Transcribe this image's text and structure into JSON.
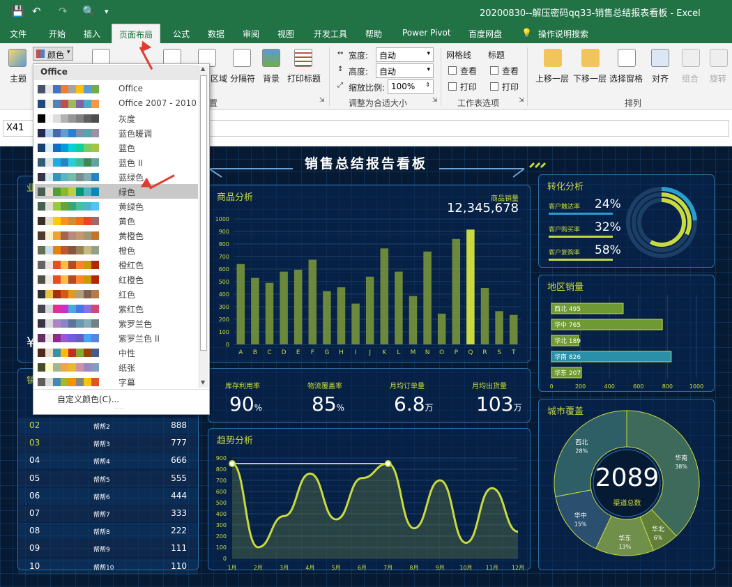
{
  "app": {
    "title": "20200830--解压密码qq33-销售总结报表看板 - Excel"
  },
  "tabs": [
    "文件",
    "开始",
    "插入",
    "页面布局",
    "公式",
    "数据",
    "审阅",
    "视图",
    "开发工具",
    "帮助",
    "Power Pivot",
    "百度网盘",
    "操作说明搜索"
  ],
  "active_tab": "页面布局",
  "ribbon": {
    "theme_label": "主题",
    "colors_label": "颜色",
    "page_setup": {
      "margin_label": "区域",
      "breaks_label": "分隔符",
      "background_label": "背景",
      "print_titles_label": "打印标题",
      "group_label": "置"
    },
    "scale": {
      "width_label": "宽度:",
      "width_value": "自动",
      "height_label": "高度:",
      "height_value": "自动",
      "zoom_label": "缩放比例:",
      "zoom_value": "100%",
      "group_label": "调整为合适大小"
    },
    "sheet_options": {
      "gridlines_label": "网格线",
      "headings_label": "标题",
      "view_label": "查看",
      "print_label": "打印",
      "group_label": "工作表选项"
    },
    "arrange": {
      "bring_forward": "上移一层",
      "send_backward": "下移一层",
      "selection_pane": "选择窗格",
      "align": "对齐",
      "group": "组合",
      "rotate": "旋转",
      "group_label": "排列"
    }
  },
  "formula_bar": {
    "name_box": "X41",
    "formula": ""
  },
  "colors_menu": {
    "header": "Office",
    "custom_label": "自定义颜色(C)...",
    "items": [
      {
        "name": "Office",
        "colors": [
          "#44546a",
          "#e7e6e6",
          "#4472c4",
          "#ed7d31",
          "#a5a5a5",
          "#ffc000",
          "#5b9bd5",
          "#70ad47"
        ]
      },
      {
        "name": "Office 2007 - 2010",
        "colors": [
          "#1f497d",
          "#eeece1",
          "#4f81bd",
          "#c0504d",
          "#9bbb59",
          "#8064a2",
          "#4bacc6",
          "#f79646"
        ]
      },
      {
        "name": "灰度",
        "colors": [
          "#000000",
          "#f8f8f8",
          "#dddddd",
          "#b2b2b2",
          "#969696",
          "#808080",
          "#5f5f5f",
          "#4d4d4d"
        ]
      },
      {
        "name": "蓝色暖调",
        "colors": [
          "#242852",
          "#acccea",
          "#4a66ac",
          "#629dd1",
          "#297fd5",
          "#7f8fa9",
          "#5aa2ae",
          "#9d90a0"
        ]
      },
      {
        "name": "蓝色",
        "colors": [
          "#17406d",
          "#dbeff9",
          "#0f6fc6",
          "#009dd9",
          "#0bd0d9",
          "#10cf9b",
          "#7cca62",
          "#a5c249"
        ]
      },
      {
        "name": "蓝色 II",
        "colors": [
          "#335b74",
          "#dfe3e5",
          "#1cade4",
          "#2683c6",
          "#27ced7",
          "#42ba97",
          "#3e8853",
          "#62a39f"
        ]
      },
      {
        "name": "蓝绿色",
        "colors": [
          "#373545",
          "#ceedf2",
          "#3494ba",
          "#58b6c0",
          "#75bda7",
          "#7a8c8e",
          "#84acb6",
          "#2683c6"
        ]
      },
      {
        "name": "绿色",
        "colors": [
          "#455f51",
          "#e3ded1",
          "#549e39",
          "#8ab833",
          "#c0cf3a",
          "#029676",
          "#4ab5c4",
          "#0989b1"
        ]
      },
      {
        "name": "黄绿色",
        "colors": [
          "#455f51",
          "#e3ded1",
          "#99cb38",
          "#63a537",
          "#37a76f",
          "#44c1a3",
          "#4eb3cf",
          "#51c3f9"
        ]
      },
      {
        "name": "黄色",
        "colors": [
          "#39302a",
          "#e5dec8",
          "#ffca08",
          "#f8931d",
          "#ce8d3e",
          "#ec7016",
          "#e64823",
          "#9c6a6a"
        ]
      },
      {
        "name": "黄橙色",
        "colors": [
          "#4e3b30",
          "#fbeec9",
          "#f0a22e",
          "#a5644e",
          "#b58b80",
          "#c3986d",
          "#a19574",
          "#c17529"
        ]
      },
      {
        "name": "橙色",
        "colors": [
          "#637052",
          "#ccddea",
          "#e48312",
          "#bd582c",
          "#865640",
          "#9b8357",
          "#c2bc80",
          "#94a088"
        ]
      },
      {
        "name": "橙红色",
        "colors": [
          "#696464",
          "#e9e5dc",
          "#e84c22",
          "#ffbd47",
          "#b64926",
          "#ff8427",
          "#cc9900",
          "#b22600"
        ]
      },
      {
        "name": "红橙色",
        "colors": [
          "#505046",
          "#eeece1",
          "#e84c22",
          "#ffbd47",
          "#b64926",
          "#ff8427",
          "#cc9900",
          "#b22600"
        ]
      },
      {
        "name": "红色",
        "colors": [
          "#323232",
          "#e5c243",
          "#a5300f",
          "#d55816",
          "#e19825",
          "#b19c7d",
          "#7f5f52",
          "#b27d49"
        ]
      },
      {
        "name": "紫红色",
        "colors": [
          "#454551",
          "#d8d9dc",
          "#e32d91",
          "#c830cc",
          "#4ea6dc",
          "#4775e7",
          "#8971e1",
          "#d54773"
        ]
      },
      {
        "name": "紫罗兰色",
        "colors": [
          "#373545",
          "#dcd8dc",
          "#ad84c6",
          "#8784c7",
          "#5d739a",
          "#6997af",
          "#84acb6",
          "#6f8183"
        ]
      },
      {
        "name": "紫罗兰色 II",
        "colors": [
          "#632e62",
          "#eae5eb",
          "#92278f",
          "#9b57d3",
          "#755dd9",
          "#665eb8",
          "#45a5ed",
          "#5982db"
        ]
      },
      {
        "name": "中性",
        "colors": [
          "#4f271c",
          "#e7dec9",
          "#3891a7",
          "#feb80a",
          "#c32d2e",
          "#84aa33",
          "#964305",
          "#475a8d"
        ]
      },
      {
        "name": "纸张",
        "colors": [
          "#444d26",
          "#fefac9",
          "#a5b592",
          "#f3a447",
          "#e7bc29",
          "#d092a7",
          "#9c85c0",
          "#809ec2"
        ]
      },
      {
        "name": "字幕",
        "colors": [
          "#5e5e5e",
          "#ddddde",
          "#418ab3",
          "#a6b727",
          "#f69200",
          "#838383",
          "#fec306",
          "#df5327"
        ]
      }
    ],
    "selected": "绿色"
  },
  "dashboard": {
    "title": "销售总结报告看板",
    "product_panel": {
      "title": "商品分析",
      "total_label": "商品销量",
      "total_value": "12,345,678"
    },
    "conversion": {
      "title": "转化分析",
      "rows": [
        {
          "label": "客户触达率",
          "value": "24%"
        },
        {
          "label": "客户购买率",
          "value": "32%"
        },
        {
          "label": "客户复购率",
          "value": "58%"
        }
      ]
    },
    "region": {
      "title": "地区销量"
    },
    "kpis": [
      {
        "label": "库存利用率",
        "value": "90",
        "unit": "%"
      },
      {
        "label": "物流覆盖率",
        "value": "85",
        "unit": "%"
      },
      {
        "label": "月均订单量",
        "value": "6.8",
        "unit": "万"
      },
      {
        "label": "月均出货量",
        "value": "103",
        "unit": "万"
      }
    ],
    "trend": {
      "title": "趋势分析"
    },
    "city": {
      "title": "城市覆盖",
      "center_value": "2089",
      "center_label": "渠道总数"
    },
    "left_top": {
      "title": "业",
      "value": "¥"
    },
    "left_table": {
      "title": "销",
      "rows": [
        {
          "rank": "02",
          "name": "帮帮2",
          "value": "888"
        },
        {
          "rank": "03",
          "name": "帮帮3",
          "value": "777"
        },
        {
          "rank": "04",
          "name": "帮帮4",
          "value": "666"
        },
        {
          "rank": "05",
          "name": "帮帮5",
          "value": "555"
        },
        {
          "rank": "06",
          "name": "帮帮6",
          "value": "444"
        },
        {
          "rank": "07",
          "name": "帮帮7",
          "value": "333"
        },
        {
          "rank": "08",
          "name": "帮帮8",
          "value": "222"
        },
        {
          "rank": "09",
          "name": "帮帮9",
          "value": "111"
        },
        {
          "rank": "10",
          "name": "帮帮10",
          "value": "110"
        }
      ]
    }
  },
  "chart_data": [
    {
      "type": "bar",
      "title": "商品分析",
      "categories": [
        "A",
        "B",
        "C",
        "D",
        "E",
        "F",
        "G",
        "H",
        "I",
        "J",
        "K",
        "L",
        "M",
        "N",
        "O",
        "P",
        "Q",
        "R",
        "S",
        "T"
      ],
      "values": [
        640,
        530,
        490,
        580,
        595,
        675,
        425,
        455,
        325,
        540,
        765,
        580,
        385,
        740,
        245,
        840,
        915,
        450,
        265,
        235
      ],
      "ylim": [
        0,
        1000
      ],
      "yticks": [
        0,
        100,
        200,
        300,
        400,
        500,
        600,
        700,
        800,
        900,
        1000
      ],
      "highlight": "Q",
      "highlight_color": "#c9da3f"
    },
    {
      "type": "bar",
      "orientation": "horizontal",
      "title": "地区销量",
      "categories": [
        "西北",
        "华中",
        "华北",
        "华南",
        "华东"
      ],
      "values": [
        495,
        765,
        189,
        826,
        207
      ],
      "xlim": [
        0,
        1000
      ],
      "xticks": [
        0,
        200,
        400,
        600,
        800,
        1000
      ]
    },
    {
      "type": "line",
      "title": "趋势分析",
      "categories": [
        "1月",
        "2月",
        "3月",
        "4月",
        "5月",
        "6月",
        "7月",
        "8月",
        "9月",
        "10月",
        "11月",
        "12月"
      ],
      "values": [
        850,
        100,
        380,
        760,
        350,
        720,
        850,
        270,
        700,
        140,
        630,
        240
      ],
      "ylim": [
        0,
        900
      ],
      "yticks": [
        0,
        100,
        200,
        300,
        400,
        500,
        600,
        700,
        800,
        900
      ]
    },
    {
      "type": "pie",
      "title": "城市覆盖",
      "labels": [
        "华南",
        "华北",
        "华东",
        "华中",
        "西北"
      ],
      "values": [
        38,
        6,
        13,
        15,
        28
      ],
      "value_labels": [
        "38%",
        "6%",
        "13%",
        "15%",
        "28%"
      ]
    },
    {
      "type": "pie",
      "title": "转化分析",
      "labels": [
        "客户触达率",
        "客户购买率",
        "客户复购率"
      ],
      "values": [
        24,
        32,
        58
      ]
    }
  ]
}
